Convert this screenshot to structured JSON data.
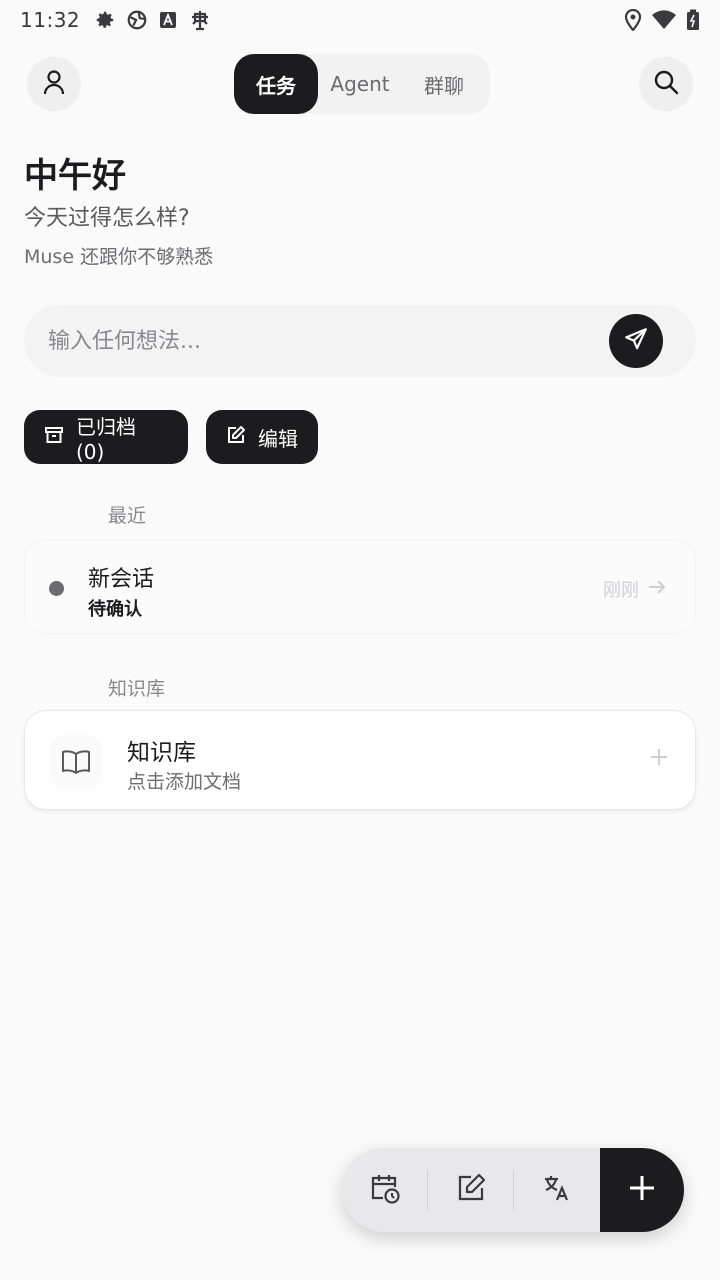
{
  "status_bar": {
    "time": "11:32",
    "left_icons": [
      "gear-icon",
      "globe-icon",
      "a-badge-icon",
      "bug-icon"
    ],
    "right_icons": [
      "location-icon",
      "wifi-icon",
      "battery-icon"
    ]
  },
  "header": {
    "tabs": [
      {
        "label": "任务",
        "active": true
      },
      {
        "label": "Agent",
        "active": false
      },
      {
        "label": "群聊",
        "active": false
      }
    ]
  },
  "greeting": {
    "title": "中午好",
    "subtitle": "今天过得怎么样?",
    "note": "Muse 还跟你不够熟悉"
  },
  "composer": {
    "placeholder": "输入任何想法..."
  },
  "actions": {
    "archived_label": "已归档 (0)",
    "edit_label": "编辑"
  },
  "recent": {
    "section_label": "最近",
    "items": [
      {
        "title": "新会话",
        "status": "待确认",
        "time": "刚刚"
      }
    ]
  },
  "knowledge": {
    "section_label": "知识库",
    "card_title": "知识库",
    "card_subtitle": "点击添加文档"
  },
  "fab": {
    "items": [
      "calendar-clock-icon",
      "edit-icon",
      "translate-icon"
    ],
    "primary": "plus-icon"
  },
  "colors": {
    "accent": "#1c1c1e",
    "background": "#fafafa"
  }
}
